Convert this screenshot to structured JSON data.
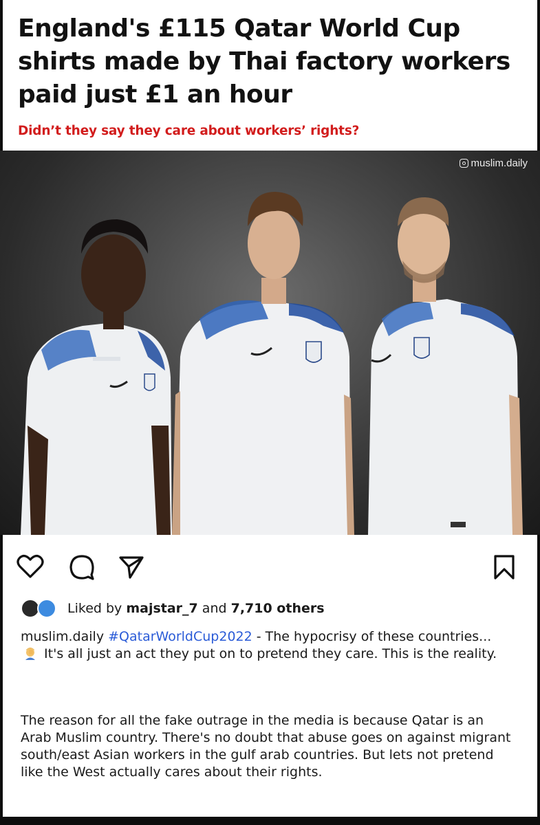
{
  "article": {
    "headline": "England's £115 Qatar World Cup shirts made by Thai factory workers paid just £1 an hour",
    "subheadline": "Didn’t they say they care about workers’ rights?"
  },
  "photo": {
    "watermark": "muslim.daily",
    "watermark_icon": "instagram-icon"
  },
  "post_actions": {
    "like_icon": "heart-icon",
    "comment_icon": "comment-icon",
    "share_icon": "send-icon",
    "save_icon": "bookmark-icon"
  },
  "likes": {
    "prefix": "Liked by ",
    "user": "majstar_7",
    "middle": " and ",
    "count": "7,710 others"
  },
  "caption": {
    "username": "muslim.daily",
    "hashtag": "#QatarWorldCup2022",
    "text_part1": " - The hypocrisy of these countries...",
    "text_part2": " It's all just an act they put on to pretend they care. This is the reality.",
    "emoji": "person-facepalming-emoji"
  },
  "body": {
    "paragraph": "The reason for all the fake outrage in the media is because Qatar is an Arab Muslim country. There's no doubt that abuse goes on against migrant south/east Asian workers in the gulf arab countries. But lets not pretend like the West actually cares about their rights."
  },
  "colors": {
    "subheadline": "#d21d1d",
    "hashtag": "#2a5bd7",
    "background": "#ffffff"
  }
}
